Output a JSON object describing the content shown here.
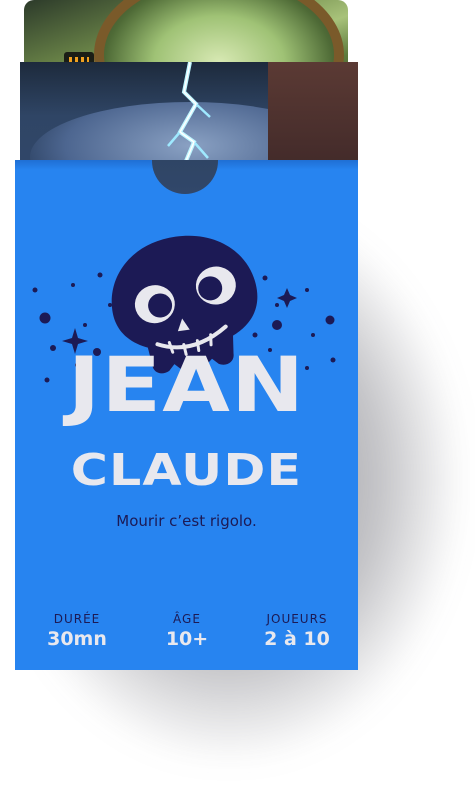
{
  "product": {
    "title_line1": "JEAN",
    "title_line2": "CLAUDE",
    "tagline": "Mourir c’est rigolo."
  },
  "stats": [
    {
      "label": "DURÉE",
      "value": "30mn"
    },
    {
      "label": "ÂGE",
      "value": "10+"
    },
    {
      "label": "JOUEURS",
      "value": "2 à 10"
    }
  ],
  "colors": {
    "box": "#2784f0",
    "skull": "#1c1a55",
    "title": "#e8e8ee",
    "text_dark": "#1c1a55"
  },
  "icons": {
    "mascot": "skull-icon",
    "decoration": "star-icon"
  }
}
